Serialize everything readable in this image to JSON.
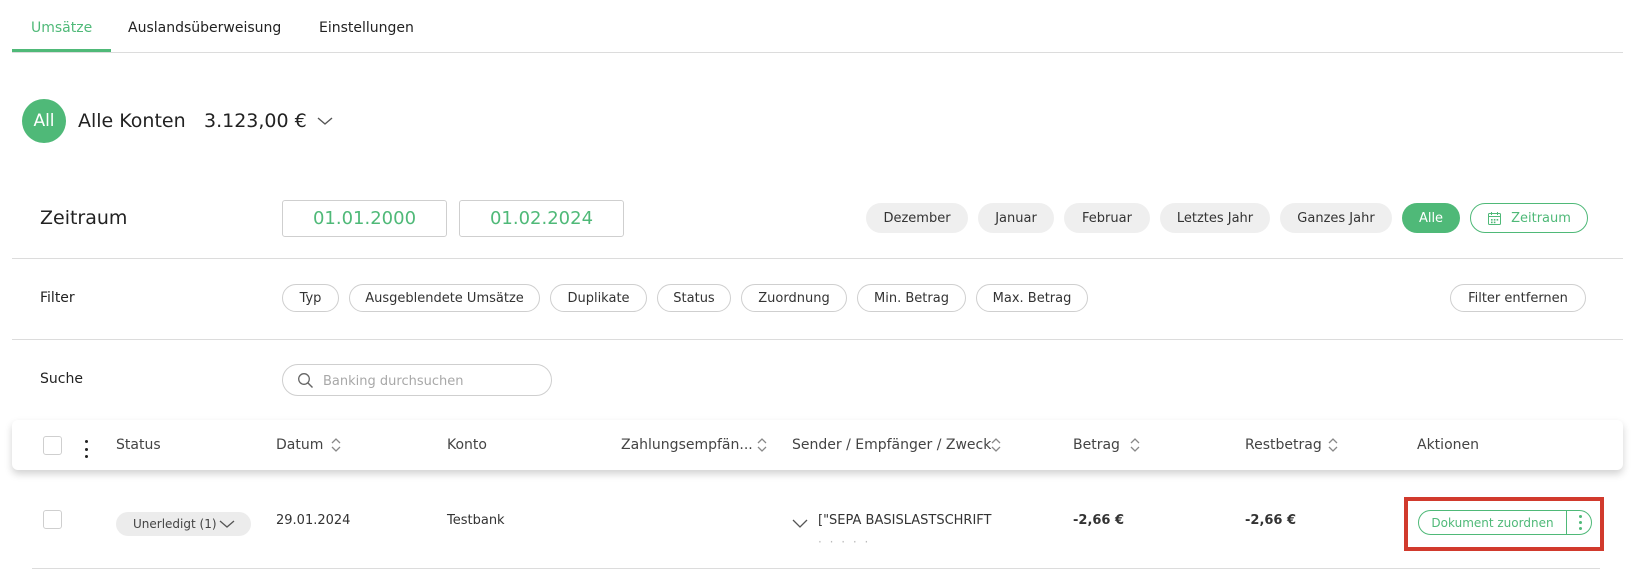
{
  "tabs": [
    {
      "label": "Umsätze"
    },
    {
      "label": "Auslandsüberweisung"
    },
    {
      "label": "Einstellungen"
    }
  ],
  "account": {
    "avatar": "All",
    "name": "Alle Konten",
    "balance": "3.123,00 €"
  },
  "zeitraum": {
    "label": "Zeitraum",
    "from": "01.01.2000",
    "to": "01.02.2024",
    "presets": [
      "Dezember",
      "Januar",
      "Februar",
      "Letztes Jahr",
      "Ganzes Jahr",
      "Alle"
    ],
    "custom_label": "Zeitraum"
  },
  "filter": {
    "label": "Filter",
    "chips": [
      "Typ",
      "Ausgeblendete Umsätze",
      "Duplikate",
      "Status",
      "Zuordnung",
      "Min. Betrag",
      "Max. Betrag"
    ],
    "remove_label": "Filter entfernen"
  },
  "search": {
    "label": "Suche",
    "placeholder": "Banking durchsuchen"
  },
  "table": {
    "columns": [
      "Status",
      "Datum",
      "Konto",
      "Zahlungsempfän...",
      "Sender / Empfänger / Zweck",
      "Betrag",
      "Restbetrag",
      "Aktionen"
    ],
    "rows": [
      {
        "status": "Unerledigt (1)",
        "datum": "29.01.2024",
        "konto": "Testbank",
        "empfaenger": "",
        "zweck": "[\"SEPA BASISLASTSCHRIFT",
        "zweck_sub": "· · · · ·",
        "betrag": "-2,66 €",
        "restbetrag": "-2,66 €",
        "action_label": "Dokument zuordnen"
      }
    ]
  },
  "colors": {
    "accent": "#4fb978",
    "highlight": "#d13a2d"
  }
}
